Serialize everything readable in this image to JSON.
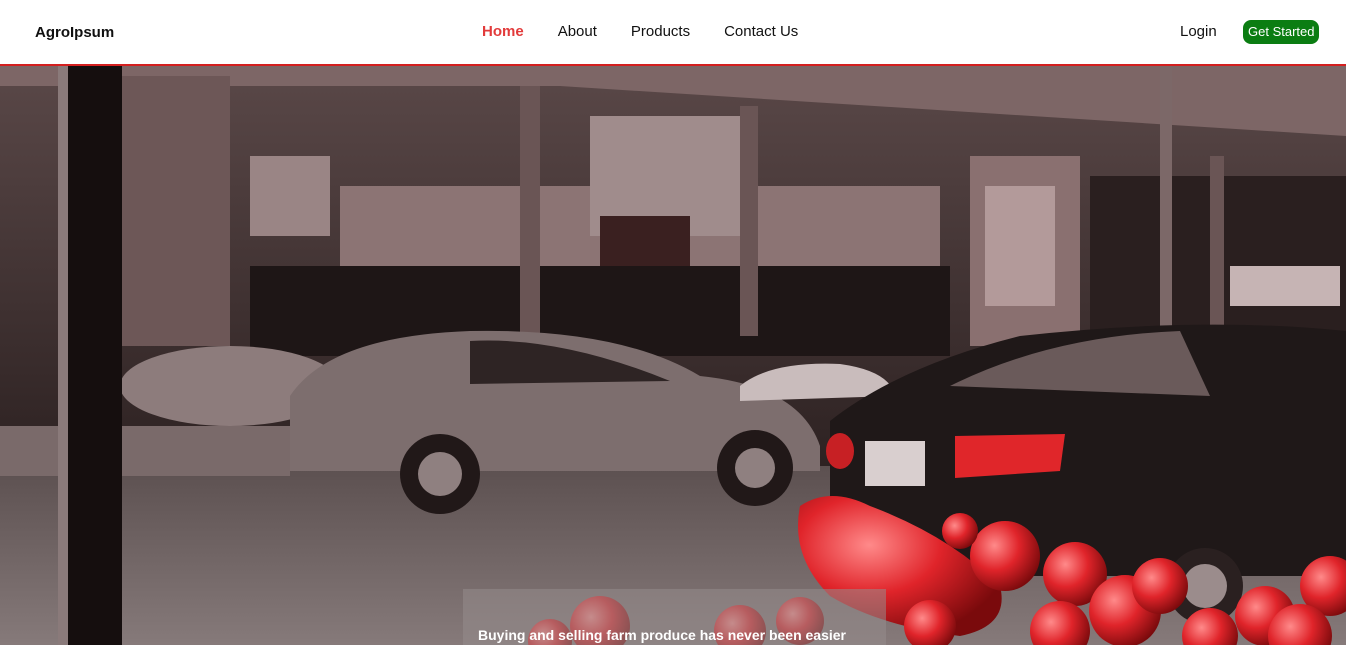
{
  "brand": {
    "name": "AgroIpsum"
  },
  "nav": {
    "items": [
      {
        "label": "Home",
        "active": true
      },
      {
        "label": "About",
        "active": false
      },
      {
        "label": "Products",
        "active": false
      },
      {
        "label": "Contact Us",
        "active": false
      }
    ],
    "login_label": "Login",
    "cta_label": "Get Started"
  },
  "hero": {
    "caption": "Buying and selling farm produce has never been easier",
    "image_description_icon": "market-street-photo"
  },
  "colors": {
    "accent_red": "#e23b3b",
    "divider_red": "#d41f1f",
    "cta_green": "#0b7d12"
  }
}
